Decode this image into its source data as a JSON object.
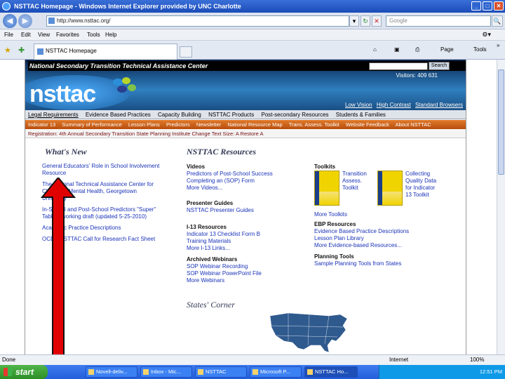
{
  "window": {
    "title": "NSTTAC Homepage - Windows Internet Explorer provided by UNC Charlotte",
    "min": "_",
    "max": "□",
    "close": "✕"
  },
  "addressbar": {
    "back": "◀",
    "forward": "▶",
    "url": "http://www.nsttac.org/",
    "dropdown": "▾",
    "refresh": "↻",
    "stop": "✕",
    "search_placeholder": "Google",
    "search_go": "🔍"
  },
  "menubar": {
    "items": [
      "File",
      "Edit",
      "View",
      "Favorites",
      "Tools",
      "Help"
    ]
  },
  "tabbar": {
    "tab_label": "NSTTAC Homepage",
    "home": "⌂",
    "feeds": "▣",
    "print": "⎙",
    "page": "Page",
    "tools": "Tools",
    "more": "»"
  },
  "site": {
    "tagline": "National Secondary Transition Technical Assistance Center",
    "search_button": "Search",
    "visitors": "Visitors: 409 631",
    "logo": "nsttac",
    "access": [
      "Low Vision",
      "High Contrast",
      "Standard Browsers"
    ],
    "mainnav": [
      "Legal Requirements",
      "Evidence Based Practices",
      "Capacity Building",
      "NSTTAC Products",
      "Post-secondary Resources",
      "Students & Families"
    ],
    "subnav": [
      "Indicator 13",
      "Summary of Performance",
      "Lesson Plans",
      "Predictors",
      "Newsletter",
      "National Resource Map",
      "Trans. Assess. Toolkit",
      "Website Feedback",
      "About NSTTAC"
    ],
    "infobar": "Registration: 4th Annual Secondary Transition State Planning Institute   Change Text Size: A  Restore  A"
  },
  "whatsnew": {
    "heading": "What's New",
    "items": [
      "General Educators' Role in School Involvement Resource",
      "The National Technical Assistance Center for Children's Mental Health, Georgetown University",
      "In-School and Post-School Predictors \"Super\" Table – working draft (updated 5-25-2010)",
      "Academic Practice Descriptions",
      "OCDT/NSTTAC Call for Research Fact Sheet"
    ]
  },
  "resources": {
    "heading": "NSTTAC Resources",
    "videos_h": "Videos",
    "videos": [
      "Predictors of Post-School Success",
      "Completing an (SOP) Form",
      "More Videos..."
    ],
    "presenter_h": "Presenter Guides",
    "presenter": [
      "NSTTAC Presenter Guides"
    ],
    "i13_h": "I-13 Resources",
    "i13": [
      "Indicator 13 Checklist Form B",
      "Training Materials",
      "More I-13 Links..."
    ],
    "webinars_h": "Archived Webinars",
    "webinars": [
      "SOP Webinar Recording",
      "SOP Webinar PowerPoint File",
      "More Webinars"
    ],
    "toolkits_h": "Toolkits",
    "toolkit1": [
      "Transition",
      "Assess.",
      "Toolkit"
    ],
    "toolkit2": [
      "Collecting",
      "Quality Data",
      "for Indicator",
      "13 Toolkit"
    ],
    "more_toolkits": "More Toolkits",
    "ebp_h": "EBP Resources",
    "ebp": [
      "Evidence Based Practice Descriptions",
      "Lesson Plan Library",
      "More Evidence-based Resources..."
    ],
    "planning_h": "Planning Tools",
    "planning": [
      "Sample Planning Tools from States"
    ]
  },
  "states_corner": "States' Corner",
  "statusbar": {
    "status": "Done",
    "zone": "Internet",
    "zoom": "100%"
  },
  "taskbar": {
    "start": "start",
    "tasks": [
      "Novell-deliv...",
      "Inbox - Mic...",
      "NSTTAC",
      "Microsoft P...",
      "NSTTAC Ho..."
    ],
    "clock": "12:51 PM"
  },
  "colors": {
    "accent_orange": "#d06218",
    "link_blue": "#1a33b8",
    "arrow_red": "#e00000"
  }
}
